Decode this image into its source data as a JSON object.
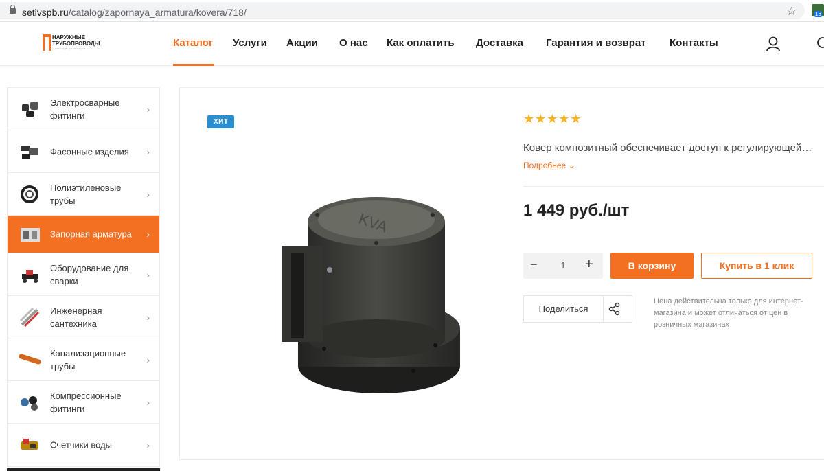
{
  "browser": {
    "url_host": "setivspb.ru",
    "url_path": "/catalog/zapornaya_armatura/kovera/718/",
    "ext_badge": "16"
  },
  "logo": {
    "line1": "НАРУЖНЫЕ",
    "line2": "ТРУБОПРОВОДЫ",
    "tagline": "надёжные трубы для вашего дома"
  },
  "nav": {
    "items": [
      "Каталог",
      "Услуги",
      "Акции",
      "О нас",
      "Как оплатить",
      "Доставка",
      "Гарантия и возврат",
      "Контакты"
    ],
    "active": "Каталог"
  },
  "sidebar": {
    "items": [
      {
        "label": "Электросварные фитинги"
      },
      {
        "label": "Фасонные изделия"
      },
      {
        "label": "Полиэтиленовые трубы"
      },
      {
        "label": "Запорная арматура"
      },
      {
        "label": "Оборудование для сварки"
      },
      {
        "label": "Инженерная сантехника"
      },
      {
        "label": "Канализационные трубы"
      },
      {
        "label": "Компрессионные фитинги"
      },
      {
        "label": "Счетчики воды"
      }
    ],
    "active": "Запорная арматура"
  },
  "product": {
    "badge": "ХИТ",
    "rating": 5,
    "stars": "★★★★★",
    "description": "Ковер композитный обеспечивает доступ к регулирующей…",
    "more": "Подробнее ⌄",
    "price": "1 449 руб./шт",
    "quantity": "1",
    "minus": "−",
    "plus": "+",
    "cart_button": "В корзину",
    "one_click_button": "Купить в 1 клик",
    "share_label": "Поделиться",
    "note": "Цена действительна только для интернет-магазина и может отличаться от цен в розничных магазинах"
  },
  "colors": {
    "accent": "#f36f21",
    "badge": "#2a8fd1",
    "star": "#f9b31c"
  }
}
